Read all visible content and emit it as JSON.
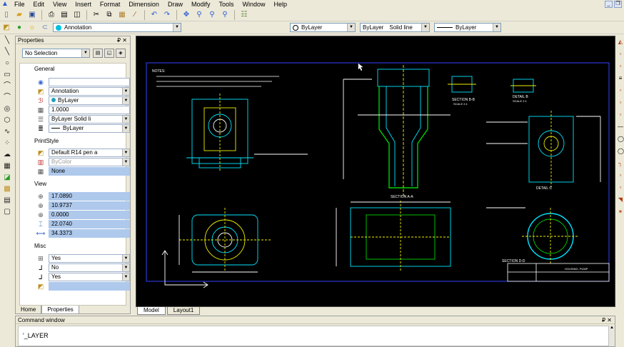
{
  "menu": [
    "File",
    "Edit",
    "View",
    "Insert",
    "Format",
    "Dimension",
    "Draw",
    "Modify",
    "Tools",
    "Window",
    "Help"
  ],
  "layer_toolbar": {
    "layer_name": "Annotation",
    "color_value": "ByLayer",
    "linetype_value": "ByLayer",
    "linetype_label": "Solid line",
    "lineweight_value": "ByLayer"
  },
  "properties": {
    "title": "Properties",
    "selection": "No Selection",
    "sections": {
      "general": "General",
      "printstyle": "PrintStyle",
      "view": "View",
      "misc": "Misc"
    },
    "general_rows": [
      "",
      "Annotation",
      "ByLayer",
      "1.0000",
      "ByLayer    Solid li",
      "ByLayer"
    ],
    "printstyle_rows": [
      "Default R14 pen a",
      "ByColor",
      "None"
    ],
    "view_rows": [
      "17.0890",
      "10.9737",
      "0.0000",
      "22.0740",
      "34.3373"
    ],
    "misc_rows": [
      "Yes",
      "No",
      "Yes",
      ""
    ],
    "tabs": [
      "Home",
      "Properties"
    ]
  },
  "layout_tabs": [
    "Model",
    "Layout1"
  ],
  "command_window": {
    "title": "Command window",
    "text": "'_LAYER"
  },
  "colors": {
    "canvas_bg": "#000000",
    "drawing_cyan": "#00e5ff",
    "drawing_yellow": "#f0f000",
    "drawing_green": "#00d000",
    "drawing_white": "#ffffff",
    "selection_blue": "#aec9ec"
  },
  "drawing_labels": {
    "notes_title": "NOTES:",
    "section_aa": "SECTION A-A",
    "section_bb": "SECTION B-B",
    "scale_bb": "SCALE 2:1",
    "detail_b": "DETAIL B",
    "scale_detail": "SCALE 2:1",
    "detail_c": "DETAIL C",
    "section_dd": "SECTION D-D",
    "title_block": "HOUSING, PUMP"
  }
}
